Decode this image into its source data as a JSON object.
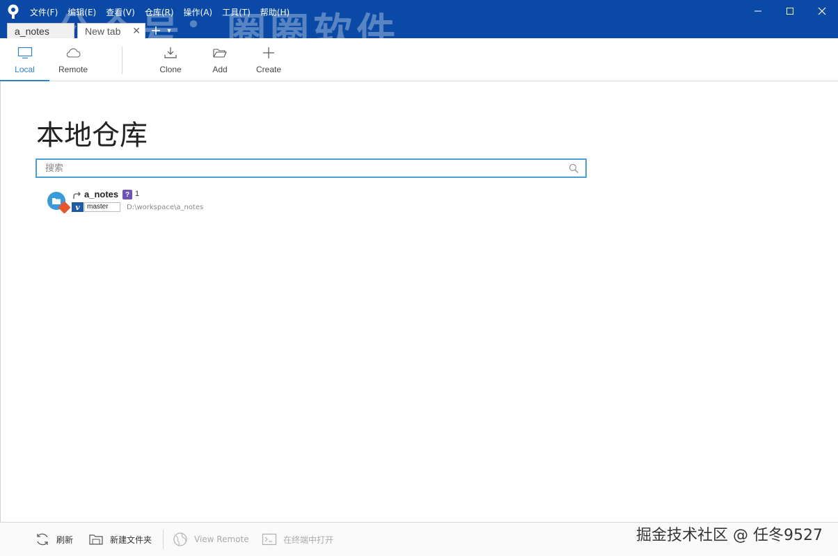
{
  "menu": [
    "文件(F)",
    "编辑(E)",
    "查看(V)",
    "仓库(R)",
    "操作(A)",
    "工具(T)",
    "帮助(H)"
  ],
  "tabs": [
    {
      "label": "a_notes"
    },
    {
      "label": "New tab"
    }
  ],
  "watermark": "公众号：圈圈软件",
  "toolbar": {
    "local": "Local",
    "remote": "Remote",
    "clone": "Clone",
    "add": "Add",
    "create": "Create"
  },
  "page": {
    "title": "本地仓库",
    "search_placeholder": "搜索"
  },
  "repos": [
    {
      "name": "a_notes",
      "status": "?",
      "count": "1",
      "branch": "master",
      "path": "D:\\workspace\\a_notes"
    }
  ],
  "bottom": {
    "refresh": "刷新",
    "new_folder": "新建文件夹",
    "view_remote": "View Remote",
    "open_terminal": "在终端中打开"
  },
  "attribution": "掘金技术社区 @ 任冬9527",
  "colors": {
    "titlebar": "#0a4aa6",
    "accent": "#2e7fc8",
    "search_border": "#4a9fd6"
  }
}
